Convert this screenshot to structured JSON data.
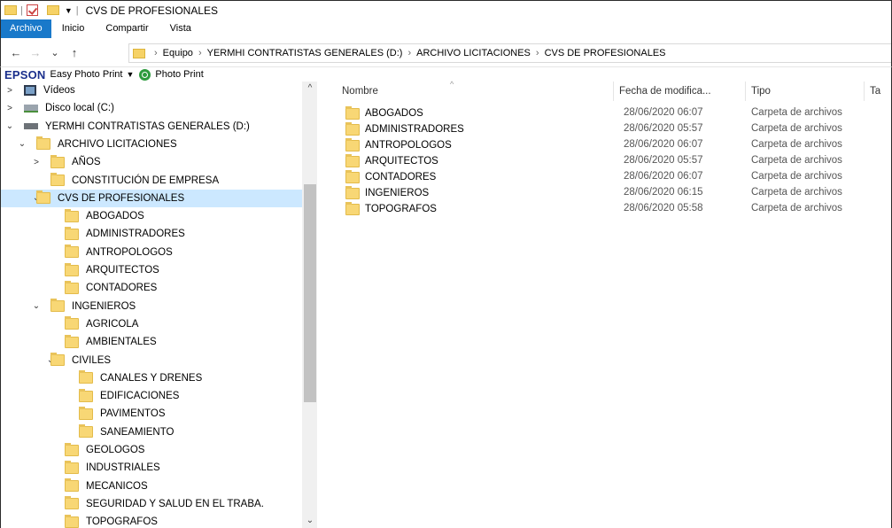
{
  "titlebar": {
    "title": "CVS DE PROFESIONALES",
    "sep1": "|",
    "sep2": "|",
    "pin": "▼"
  },
  "ribbon": {
    "tabs": [
      "Archivo",
      "Inicio",
      "Compartir",
      "Vista"
    ]
  },
  "address": {
    "back": "←",
    "forward": "→",
    "recent": "⌄",
    "up": "↑",
    "crumbs": [
      "Equipo",
      "YERMHI CONTRATISTAS GENERALES (D:)",
      "ARCHIVO LICITACIONES",
      "CVS DE PROFESIONALES"
    ],
    "sep": "›"
  },
  "epson": {
    "logo": "EPSON",
    "easy": "Easy Photo Print",
    "drop": "▼",
    "photo": "Photo Print"
  },
  "nav": {
    "items": [
      {
        "label": "Vídeos",
        "chev": ">",
        "icon": "videos"
      },
      {
        "label": "Disco local (C:)",
        "chev": ">",
        "icon": "drive"
      },
      {
        "label": "YERMHI CONTRATISTAS GENERALES (D:)",
        "chev": "⌄",
        "icon": "drive2"
      },
      {
        "label": "ARCHIVO LICITACIONES",
        "chev": "⌄",
        "icon": "folder"
      },
      {
        "label": "AÑOS",
        "chev": ">",
        "icon": "folder"
      },
      {
        "label": "CONSTITUCIÓN DE EMPRESA",
        "chev": "",
        "icon": "folder"
      },
      {
        "label": "CVS DE PROFESIONALES",
        "chev": "⌄",
        "icon": "folder",
        "selected": true
      },
      {
        "label": "ABOGADOS",
        "chev": "",
        "icon": "folder"
      },
      {
        "label": "ADMINISTRADORES",
        "chev": "",
        "icon": "folder"
      },
      {
        "label": "ANTROPOLOGOS",
        "chev": "",
        "icon": "folder"
      },
      {
        "label": "ARQUITECTOS",
        "chev": "",
        "icon": "folder"
      },
      {
        "label": "CONTADORES",
        "chev": "",
        "icon": "folder"
      },
      {
        "label": "INGENIEROS",
        "chev": "⌄",
        "icon": "folder"
      },
      {
        "label": "AGRICOLA",
        "chev": "",
        "icon": "folder"
      },
      {
        "label": "AMBIENTALES",
        "chev": "",
        "icon": "folder"
      },
      {
        "label": "CIVILES",
        "chev": "⌄",
        "icon": "folder"
      },
      {
        "label": "CANALES Y DRENES",
        "chev": "",
        "icon": "folder"
      },
      {
        "label": "EDIFICACIONES",
        "chev": "",
        "icon": "folder"
      },
      {
        "label": "PAVIMENTOS",
        "chev": "",
        "icon": "folder"
      },
      {
        "label": "SANEAMIENTO",
        "chev": "",
        "icon": "folder"
      },
      {
        "label": "GEOLOGOS",
        "chev": "",
        "icon": "folder"
      },
      {
        "label": "INDUSTRIALES",
        "chev": "",
        "icon": "folder"
      },
      {
        "label": "MECANICOS",
        "chev": "",
        "icon": "folder"
      },
      {
        "label": "SEGURIDAD Y SALUD EN EL TRABA.",
        "chev": "",
        "icon": "folder"
      },
      {
        "label": "TOPOGRAFOS",
        "chev": "",
        "icon": "folder"
      }
    ],
    "scroll_up": "^",
    "scroll_down": "⌄"
  },
  "list": {
    "columns": [
      "Nombre",
      "Fecha de modifica...",
      "Tipo",
      "Ta"
    ],
    "sort_caret": "^",
    "rows": [
      {
        "name": "ABOGADOS",
        "date": "28/06/2020 06:07",
        "type": "Carpeta de archivos"
      },
      {
        "name": "ADMINISTRADORES",
        "date": "28/06/2020 05:57",
        "type": "Carpeta de archivos"
      },
      {
        "name": "ANTROPOLOGOS",
        "date": "28/06/2020 06:07",
        "type": "Carpeta de archivos"
      },
      {
        "name": "ARQUITECTOS",
        "date": "28/06/2020 05:57",
        "type": "Carpeta de archivos"
      },
      {
        "name": "CONTADORES",
        "date": "28/06/2020 06:07",
        "type": "Carpeta de archivos"
      },
      {
        "name": "INGENIEROS",
        "date": "28/06/2020 06:15",
        "type": "Carpeta de archivos"
      },
      {
        "name": "TOPOGRAFOS",
        "date": "28/06/2020 05:58",
        "type": "Carpeta de archivos"
      }
    ]
  },
  "colors": {
    "accent": "#1979ca",
    "selection": "#cce8ff",
    "folder": "#f8d775"
  }
}
